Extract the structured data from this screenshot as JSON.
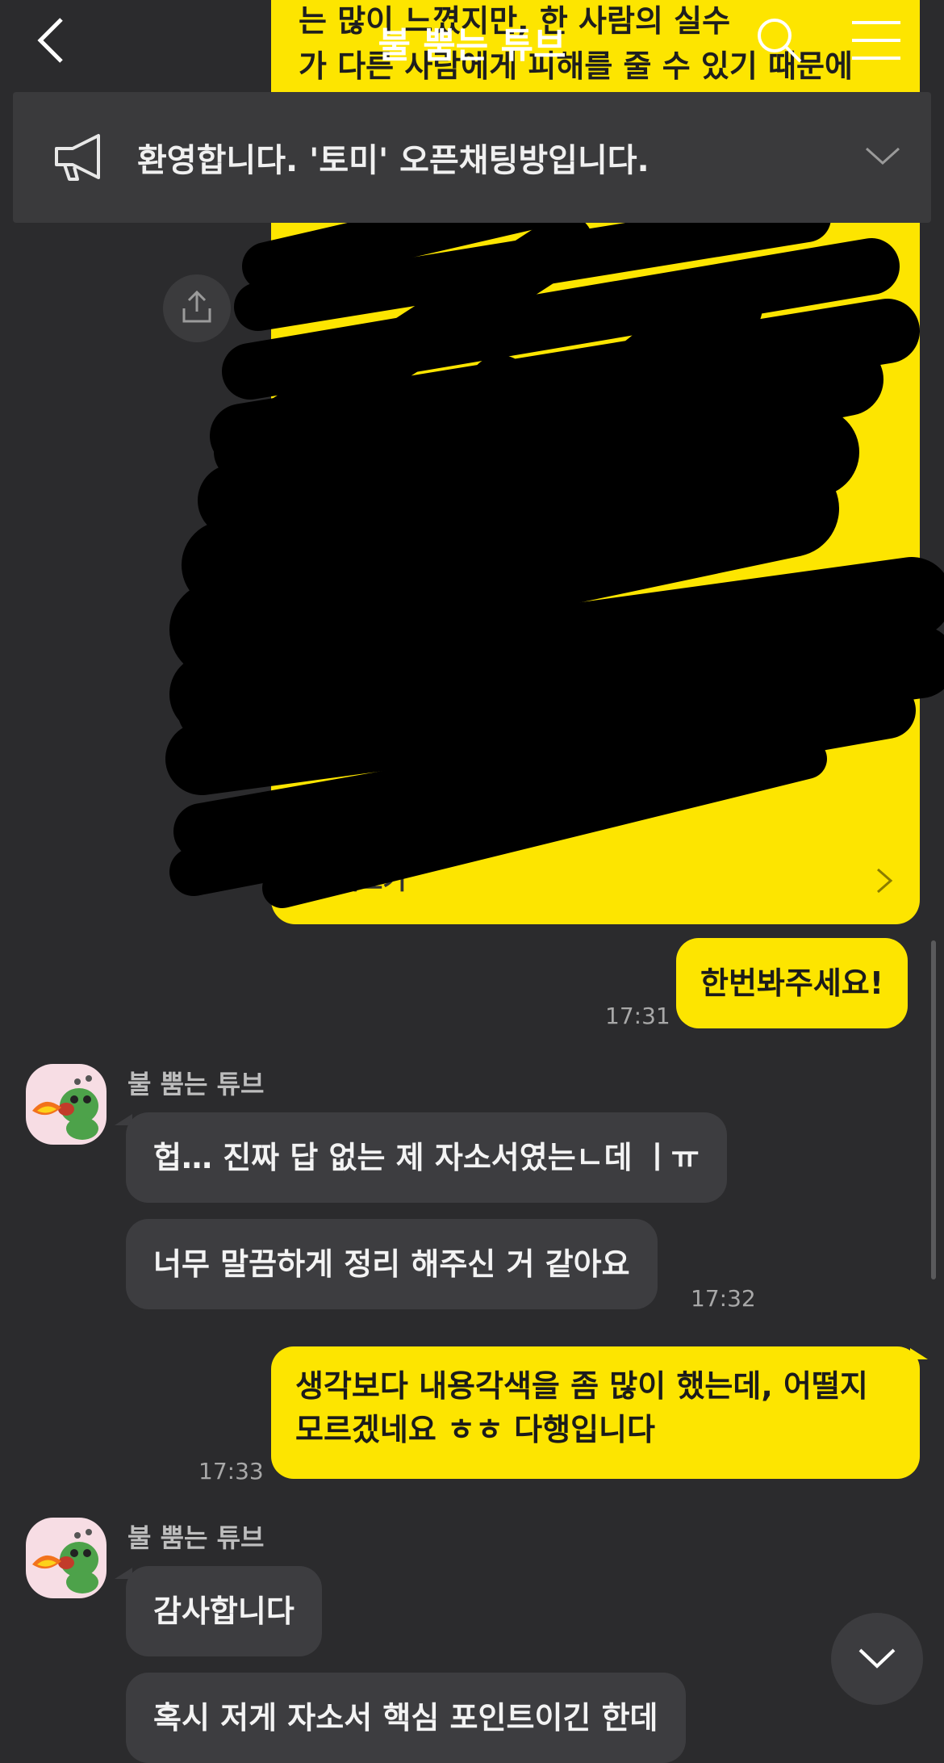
{
  "header": {
    "title": "불 뿜는 튜브"
  },
  "notice": {
    "text": "환영합니다. '토미' 오픈채팅방입니다."
  },
  "long_message": {
    "text_lines": [
      "는 많이 느꼈지만, 한 사람의 실수",
      "가 다른 사람에게 피해를 줄 수 있기 때문에"
    ],
    "more_label": "전체보기"
  },
  "messages": {
    "me1": {
      "text": "한번봐주세요!",
      "time": "17:31"
    },
    "other_sender": "불 뿜는 튜브",
    "other1": {
      "text": "헙… 진짜 답 없는 제 자소서였는ㄴ데 ㅣㅠ"
    },
    "other2": {
      "text": "너무 말끔하게 정리 해주신 거 같아요",
      "time": "17:32"
    },
    "me2": {
      "line1": "생각보다 내용각색을 좀 많이 했는데, 어떨지",
      "line2": "모르겠네요 ㅎㅎ 다행입니다",
      "time": "17:33"
    },
    "other_sender2": "불 뿜는 튜브",
    "other3": {
      "text": "감사합니다"
    },
    "other4": {
      "text": "혹시 저게 자소서 핵심 포인트이긴 한데"
    }
  },
  "colors": {
    "background": "#2b2b2d",
    "my_bubble": "#fde500",
    "other_bubble": "#3d3d40"
  }
}
